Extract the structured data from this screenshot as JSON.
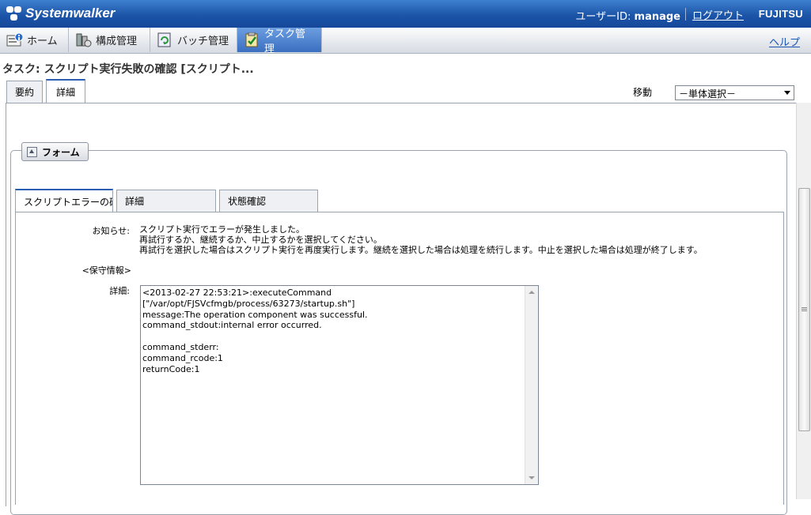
{
  "header": {
    "brand": "Systemwalker",
    "user_label": "ユーザーID: ",
    "user_id": "manage",
    "logout": "ログアウト",
    "vendor": "FUJITSU"
  },
  "nav": {
    "tabs": [
      {
        "label": "ホーム",
        "icon": "home-icon"
      },
      {
        "label": "構成管理",
        "icon": "configuration-icon"
      },
      {
        "label": "バッチ管理",
        "icon": "batch-icon"
      },
      {
        "label": "タスク管理",
        "icon": "task-icon",
        "active": true
      }
    ],
    "help": "ヘルプ"
  },
  "page": {
    "title": "タスク: スクリプト実行失敗の確認 [スクリプト...",
    "tabs": [
      "要約",
      "詳細"
    ],
    "active_tab": "詳細",
    "move_label": "移動",
    "move_select": "－単体選択－"
  },
  "form": {
    "legend": "フォーム",
    "tabs": [
      "スクリプトエラーの確",
      "詳細",
      "状態確認"
    ],
    "notice_label": "お知らせ:",
    "notice_lines": [
      "スクリプト実行でエラーが発生しました。",
      "再試行するか、継続するか、中止するかを選択してください。",
      "再試行を選択した場合はスクリプト実行を再度実行します。継続を選択した場合は処理を続行します。中止を選択した場合は処理が終了します。"
    ],
    "maintenance_label": "<保守情報>",
    "detail_label": "詳細:",
    "detail_text": "<2013-02-27 22:53:21>:executeCommand\n[\"/var/opt/FJSVcfmgb/process/63273/startup.sh\"]\nmessage:The operation component was successful.\ncommand_stdout:internal error occurred.\n\ncommand_stderr:\ncommand_rcode:1\nreturnCode:1"
  }
}
